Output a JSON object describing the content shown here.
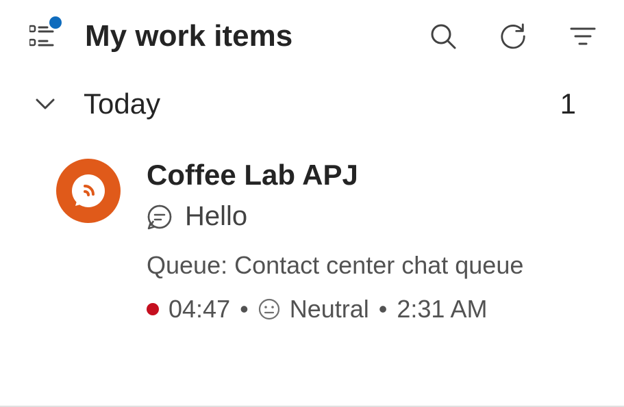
{
  "header": {
    "title": "My work items",
    "icons": {
      "list": "list-icon",
      "search": "search-icon",
      "refresh": "refresh-icon",
      "filter": "filter-icon"
    }
  },
  "section": {
    "label": "Today",
    "count": "1"
  },
  "item": {
    "title": "Coffee Lab APJ",
    "message": "Hello",
    "queue_label": "Queue: Contact center chat queue",
    "timer": "04:47",
    "sentiment": "Neutral",
    "timestamp": "2:31 AM"
  }
}
